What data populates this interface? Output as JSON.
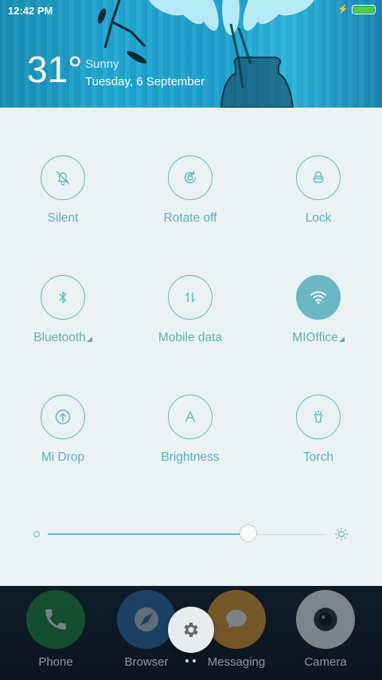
{
  "status_bar": {
    "time": "12:42 PM",
    "battery_color": "#4cd137"
  },
  "weather": {
    "temperature": "31°",
    "condition": "Sunny",
    "date": "Tuesday, 6 September"
  },
  "toggles": [
    {
      "label": "Silent",
      "icon": "bell-off-icon",
      "active": false
    },
    {
      "label": "Rotate off",
      "icon": "rotate-lock-icon",
      "active": false
    },
    {
      "label": "Lock",
      "icon": "lock-icon",
      "active": false
    },
    {
      "label": "Bluetooth",
      "icon": "bluetooth-icon",
      "active": false
    },
    {
      "label": "Mobile data",
      "icon": "mobile-data-icon",
      "active": false
    },
    {
      "label": "MIOffice",
      "icon": "wifi-icon",
      "active": true
    },
    {
      "label": "Mi Drop",
      "icon": "mi-drop-icon",
      "active": false
    },
    {
      "label": "Brightness",
      "icon": "brightness-auto-icon",
      "active": false
    },
    {
      "label": "Torch",
      "icon": "torch-icon",
      "active": false
    }
  ],
  "brightness": {
    "level": 0.72
  },
  "dock": [
    {
      "label": "Phone",
      "icon": "phone-icon",
      "color": "#1e8e3e"
    },
    {
      "label": "Browser",
      "icon": "browser-icon",
      "color": "#2f6fb0"
    },
    {
      "label": "Messaging",
      "icon": "messaging-icon",
      "color": "#f2a32a"
    },
    {
      "label": "Camera",
      "icon": "camera-icon",
      "color": "#d9dde0"
    }
  ],
  "colors": {
    "accent": "#69b8c4",
    "panel_bg": "#ebf2f3"
  }
}
